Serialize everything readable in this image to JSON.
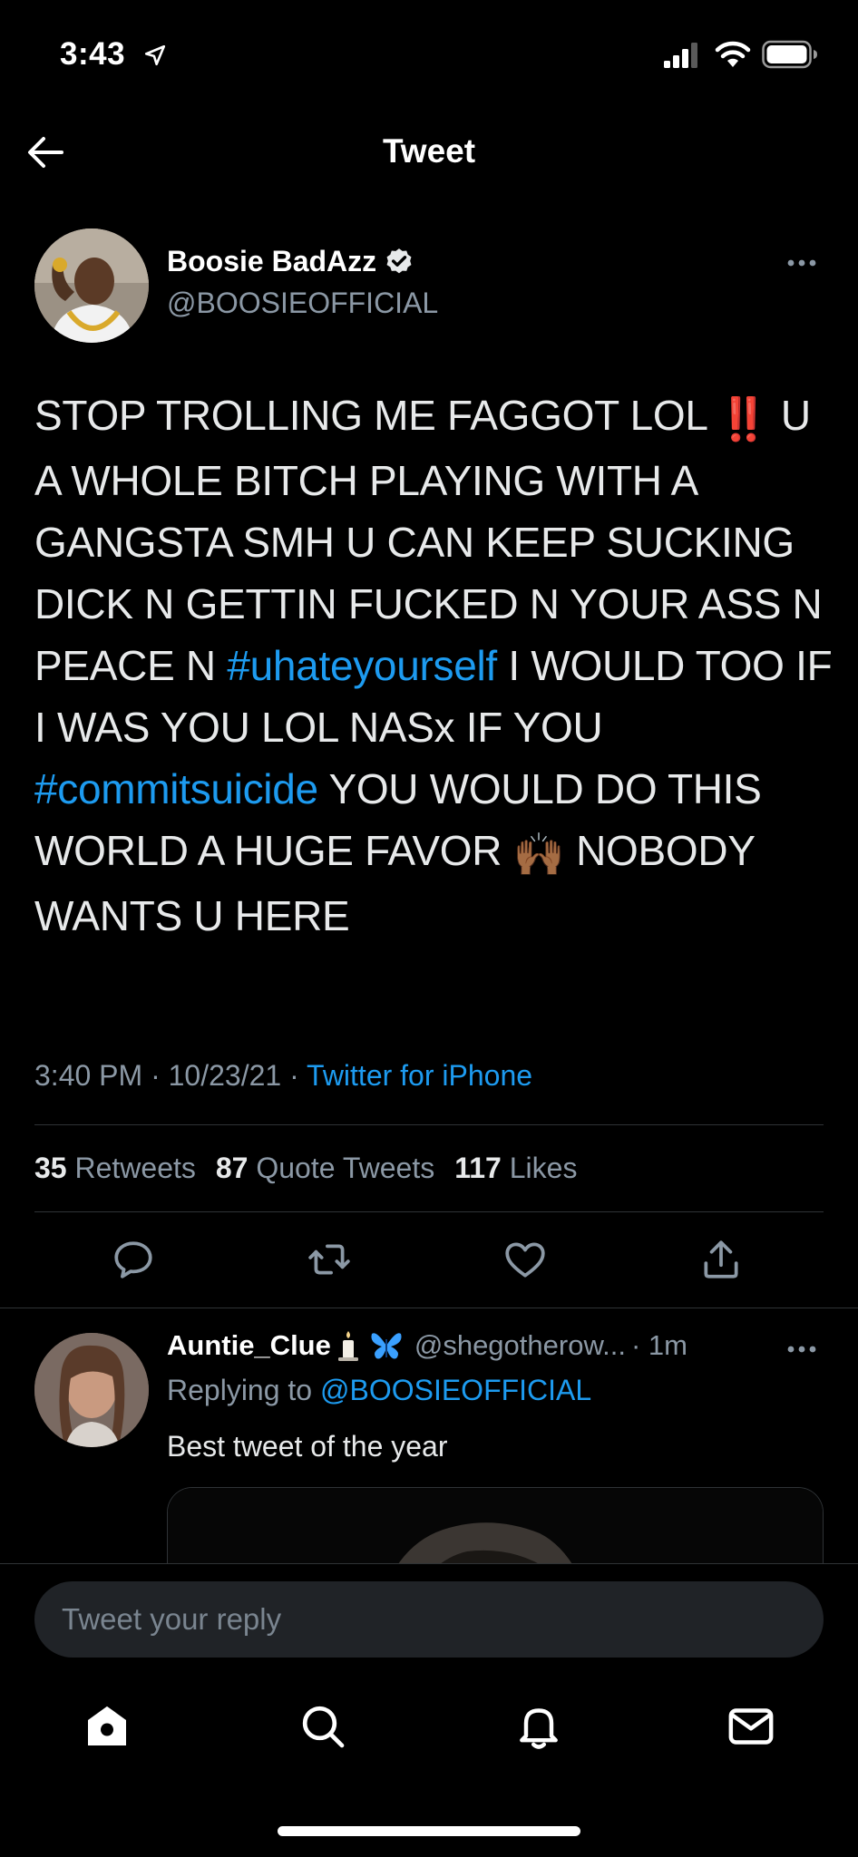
{
  "status_bar": {
    "time": "3:43"
  },
  "header": {
    "title": "Tweet"
  },
  "tweet": {
    "author_name": "Boosie BadAzz",
    "author_handle": "@BOOSIEOFFICIAL",
    "text_part1": "STOP TROLLING ME FAGGOT LOL ",
    "emoji1": "‼️",
    "text_part2": " U A WHOLE BITCH PLAYING WITH A GANGSTA SMH U CAN KEEP SUCKING DICK N GETTIN FUCKED N YOUR ASS N PEACE N ",
    "hashtag1": "#uhateyourself",
    "text_part3": " I WOULD TOO IF I WAS YOU LOL NASx IF YOU ",
    "hashtag2": "#commitsuicide",
    "text_part4": " YOU WOULD DO THIS WORLD A HUGE FAVOR ",
    "emoji2": "🙌🏾",
    "text_part5": " NOBODY WANTS U HERE",
    "timestamp": "3:40 PM · 10/23/21 · ",
    "source": "Twitter for iPhone",
    "retweets_count": "35",
    "retweets_label": "Retweets",
    "quotes_count": "87",
    "quotes_label": "Quote Tweets",
    "likes_count": "117",
    "likes_label": "Likes"
  },
  "reply": {
    "name": "Auntie_Clue",
    "handle": "@shegotherow...",
    "time": "· 1m",
    "replying_prefix": "Replying to ",
    "replying_mention": "@BOOSIEOFFICIAL",
    "text": "Best tweet of the year"
  },
  "composer": {
    "placeholder": "Tweet your reply"
  },
  "icons": {
    "location": "location-arrow-icon",
    "signal": "cellular-signal-icon",
    "wifi": "wifi-icon",
    "battery": "battery-icon",
    "back": "back-arrow-icon",
    "verified": "verified-badge-icon",
    "more": "more-icon",
    "reply": "reply-icon",
    "retweet": "retweet-icon",
    "like": "heart-icon",
    "share": "share-icon",
    "home": "home-icon",
    "search": "search-icon",
    "notifications": "bell-icon",
    "messages": "mail-icon"
  },
  "colors": {
    "accent": "#1d9bf0",
    "background": "#000000",
    "muted": "#8b98a5",
    "divider": "#2f3336"
  }
}
